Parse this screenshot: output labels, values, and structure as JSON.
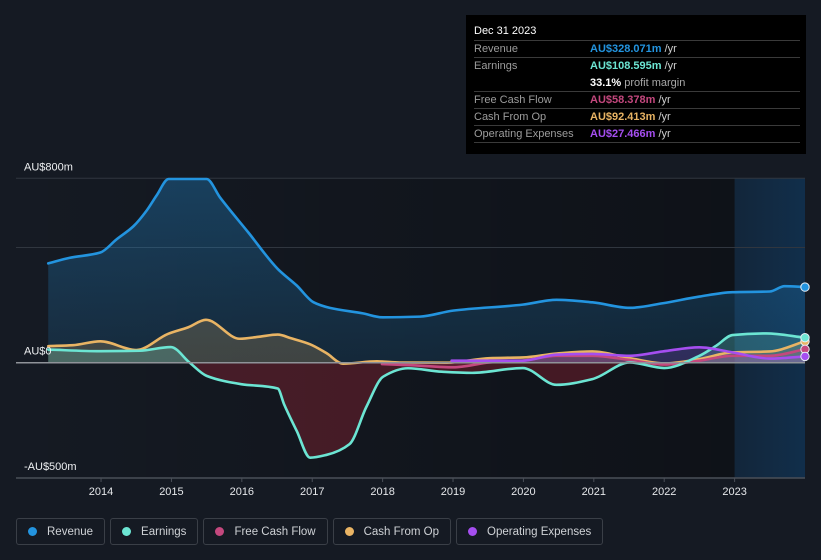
{
  "tooltip": {
    "date": "Dec 31 2023",
    "rows": [
      {
        "label": "Revenue",
        "value": "AU$328.071m",
        "unit": "/yr",
        "color": "#2394df"
      },
      {
        "label": "Earnings",
        "value": "AU$108.595m",
        "unit": "/yr",
        "color": "#6ce5d3"
      },
      {
        "label": "",
        "value": "33.1%",
        "unit": "profit margin",
        "color": "#ffffff"
      },
      {
        "label": "Free Cash Flow",
        "value": "AU$58.378m",
        "unit": "/yr",
        "color": "#c4487e"
      },
      {
        "label": "Cash From Op",
        "value": "AU$92.413m",
        "unit": "/yr",
        "color": "#e9b464"
      },
      {
        "label": "Operating Expenses",
        "value": "AU$27.466m",
        "unit": "/yr",
        "color": "#a54ef0"
      }
    ]
  },
  "legend": [
    {
      "label": "Revenue",
      "color": "#2394df"
    },
    {
      "label": "Earnings",
      "color": "#6ce5d3"
    },
    {
      "label": "Free Cash Flow",
      "color": "#c4487e"
    },
    {
      "label": "Cash From Op",
      "color": "#e9b464"
    },
    {
      "label": "Operating Expenses",
      "color": "#a54ef0"
    }
  ],
  "chart_data": {
    "type": "area",
    "title": "",
    "xlabel": "",
    "ylabel": "",
    "x_unit": "year",
    "xlim": [
      2012.792,
      2024.0
    ],
    "ylim": [
      -500,
      800
    ],
    "grid": true,
    "gridlines": [
      800,
      500
    ],
    "y_ticks": [
      {
        "value": 800,
        "label": "AU$800m"
      },
      {
        "value": 0,
        "label": "AU$0"
      },
      {
        "value": -500,
        "label": "-AU$500m"
      }
    ],
    "x_ticks": [
      {
        "value": 2014,
        "label": "2014"
      },
      {
        "value": 2015,
        "label": "2015"
      },
      {
        "value": 2016,
        "label": "2016"
      },
      {
        "value": 2017,
        "label": "2017"
      },
      {
        "value": 2018,
        "label": "2018"
      },
      {
        "value": 2019,
        "label": "2019"
      },
      {
        "value": 2020,
        "label": "2020"
      },
      {
        "value": 2021,
        "label": "2021"
      },
      {
        "value": 2022,
        "label": "2022"
      },
      {
        "value": 2023,
        "label": "2023"
      }
    ],
    "highlight_range": [
      2023.0,
      2024.0
    ],
    "legend_position": "bottom-left",
    "series": [
      {
        "name": "Revenue",
        "key": "revenue",
        "color": "#2394df",
        "points": [
          [
            2013.25,
            431
          ],
          [
            2013.55,
            455
          ],
          [
            2013.99,
            478
          ],
          [
            2014.22,
            535
          ],
          [
            2014.46,
            592
          ],
          [
            2014.65,
            661
          ],
          [
            2014.79,
            726
          ],
          [
            2014.96,
            797
          ],
          [
            2015.5,
            797
          ],
          [
            2015.69,
            717
          ],
          [
            2016.09,
            566
          ],
          [
            2016.51,
            407
          ],
          [
            2016.78,
            335
          ],
          [
            2017.02,
            262
          ],
          [
            2017.25,
            238
          ],
          [
            2017.72,
            214
          ],
          [
            2018.0,
            197
          ],
          [
            2018.53,
            200
          ],
          [
            2019.0,
            226
          ],
          [
            2019.99,
            252
          ],
          [
            2020.47,
            273
          ],
          [
            2020.98,
            262
          ],
          [
            2021.51,
            238
          ],
          [
            2021.98,
            258
          ],
          [
            2022.5,
            287
          ],
          [
            2022.97,
            306
          ],
          [
            2023.5,
            309
          ],
          [
            2023.71,
            332
          ],
          [
            2024.0,
            328.071
          ]
        ]
      },
      {
        "name": "Cash From Op",
        "key": "cash-from-op",
        "color": "#e9b464",
        "points": [
          [
            2013.25,
            72
          ],
          [
            2013.6,
            76
          ],
          [
            2013.99,
            93
          ],
          [
            2014.5,
            55
          ],
          [
            2014.95,
            125
          ],
          [
            2015.24,
            154
          ],
          [
            2015.49,
            186
          ],
          [
            2015.97,
            104
          ],
          [
            2016.25,
            113
          ],
          [
            2016.51,
            122
          ],
          [
            2016.7,
            106
          ],
          [
            2016.97,
            80
          ],
          [
            2017.2,
            42
          ],
          [
            2017.44,
            -4
          ],
          [
            2017.92,
            6
          ],
          [
            2018.24,
            1
          ],
          [
            2018.91,
            0
          ],
          [
            2019.52,
            20
          ],
          [
            2019.99,
            23
          ],
          [
            2020.47,
            40
          ],
          [
            2020.98,
            49
          ],
          [
            2021.51,
            20
          ],
          [
            2022.0,
            -3
          ],
          [
            2022.5,
            16
          ],
          [
            2022.97,
            45
          ],
          [
            2023.5,
            49
          ],
          [
            2024.0,
            92.413
          ]
        ]
      },
      {
        "name": "Free Cash Flow",
        "key": "free-cash-flow",
        "color": "#c4487e",
        "points": [
          [
            2017.99,
            -6
          ],
          [
            2018.43,
            -11
          ],
          [
            2019.0,
            -20
          ],
          [
            2019.52,
            1
          ],
          [
            2019.99,
            9
          ],
          [
            2020.47,
            30
          ],
          [
            2020.98,
            30
          ],
          [
            2021.51,
            12
          ],
          [
            2022.0,
            -8
          ],
          [
            2022.5,
            9
          ],
          [
            2022.97,
            30
          ],
          [
            2023.5,
            30
          ],
          [
            2024.0,
            58.378
          ]
        ]
      },
      {
        "name": "Earnings",
        "key": "earnings",
        "color": "#6ce5d3",
        "negative_color": "#be283c",
        "points": [
          [
            2013.25,
            57
          ],
          [
            2013.99,
            50
          ],
          [
            2014.55,
            52
          ],
          [
            2014.99,
            68
          ],
          [
            2015.26,
            0
          ],
          [
            2015.5,
            -57
          ],
          [
            2015.99,
            -93
          ],
          [
            2016.51,
            -112
          ],
          [
            2016.6,
            -180
          ],
          [
            2016.78,
            -296
          ],
          [
            2016.97,
            -412
          ],
          [
            2017.2,
            -400
          ],
          [
            2017.53,
            -353
          ],
          [
            2017.77,
            -191
          ],
          [
            2018.01,
            -60
          ],
          [
            2018.36,
            -24
          ],
          [
            2018.84,
            -39
          ],
          [
            2019.27,
            -44
          ],
          [
            2019.99,
            -23
          ],
          [
            2020.47,
            -96
          ],
          [
            2020.98,
            -71
          ],
          [
            2021.51,
            1
          ],
          [
            2022.0,
            -23
          ],
          [
            2022.5,
            30
          ],
          [
            2022.74,
            74
          ],
          [
            2022.97,
            120
          ],
          [
            2023.45,
            127
          ],
          [
            2024.0,
            108.595
          ]
        ]
      },
      {
        "name": "Operating Expenses",
        "key": "operating-expenses",
        "color": "#a54ef0",
        "points": [
          [
            2018.98,
            9
          ],
          [
            2019.99,
            9
          ],
          [
            2020.47,
            35
          ],
          [
            2020.98,
            38
          ],
          [
            2021.51,
            30
          ],
          [
            2021.98,
            49
          ],
          [
            2022.5,
            67
          ],
          [
            2022.97,
            45
          ],
          [
            2023.5,
            18
          ],
          [
            2024.0,
            27.466
          ]
        ]
      }
    ]
  }
}
